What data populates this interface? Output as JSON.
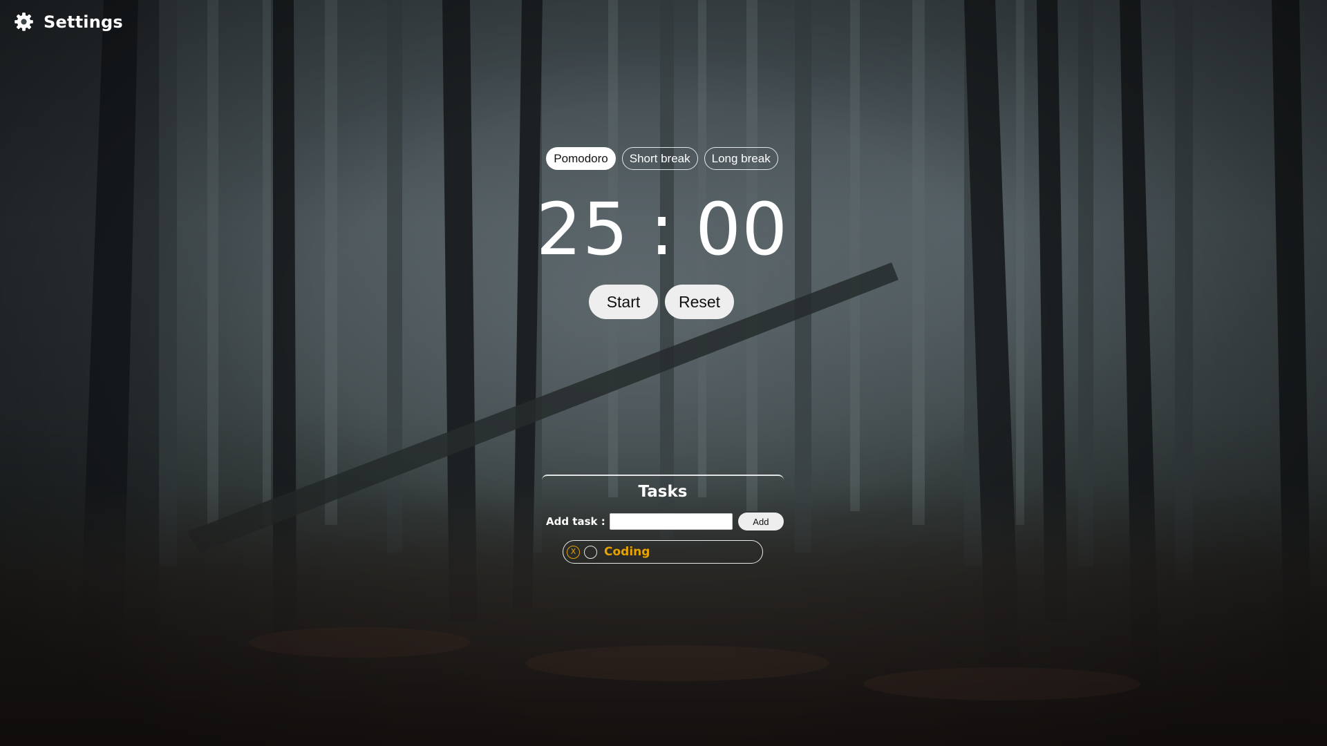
{
  "settings": {
    "label": "Settings",
    "icon": "gear-icon"
  },
  "timer": {
    "modes": [
      "Pomodoro",
      "Short break",
      "Long break"
    ],
    "active_mode": "Pomodoro",
    "minutes": "25",
    "separator": ":",
    "seconds": "00",
    "start_label": "Start",
    "reset_label": "Reset"
  },
  "tasks": {
    "title": "Tasks",
    "add_label": "Add task :",
    "input_value": "",
    "add_button_label": "Add",
    "items": [
      {
        "text": "Coding",
        "delete_glyph": "X",
        "done": false
      }
    ]
  },
  "colors": {
    "accent": "#e8a200",
    "button_bg": "#eeeeee",
    "text": "#ffffff"
  }
}
